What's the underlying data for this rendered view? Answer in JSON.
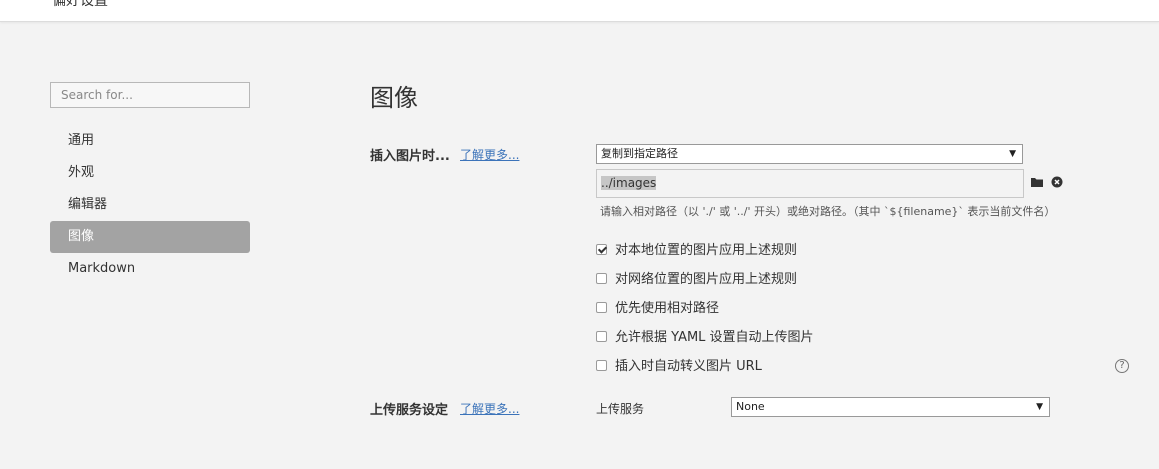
{
  "header": {
    "title": "偏好设置"
  },
  "sidebar": {
    "search_placeholder": "Search for...",
    "items": [
      {
        "label": "通用"
      },
      {
        "label": "外观"
      },
      {
        "label": "编辑器"
      },
      {
        "label": "图像",
        "active": true
      },
      {
        "label": "Markdown"
      }
    ]
  },
  "main": {
    "title": "图像",
    "insert": {
      "label": "插入图片时...",
      "learn_more": "了解更多...",
      "action_select": "复制到指定路径",
      "path_value": "../images",
      "folder_icon": "folder-icon",
      "clear_icon": "close-circle-icon",
      "hint": "请输入相对路径（以 './' 或 '../' 开头）或绝对路径。（其中 `${filename}` 表示当前文件名）",
      "options": [
        {
          "label": "对本地位置的图片应用上述规则",
          "checked": true
        },
        {
          "label": "对网络位置的图片应用上述规则",
          "checked": false
        },
        {
          "label": "优先使用相对路径",
          "checked": false
        },
        {
          "label": "允许根据 YAML 设置自动上传图片",
          "checked": false
        },
        {
          "label": "插入时自动转义图片 URL",
          "checked": false
        }
      ]
    },
    "help_icon": "?",
    "upload": {
      "label": "上传服务设定",
      "learn_more": "了解更多...",
      "service_label": "上传服务",
      "service_select": "None"
    }
  },
  "colors": {
    "accent_link": "#3b73b9",
    "active_nav": "#a3a3a3",
    "background": "#f3f3f3"
  }
}
